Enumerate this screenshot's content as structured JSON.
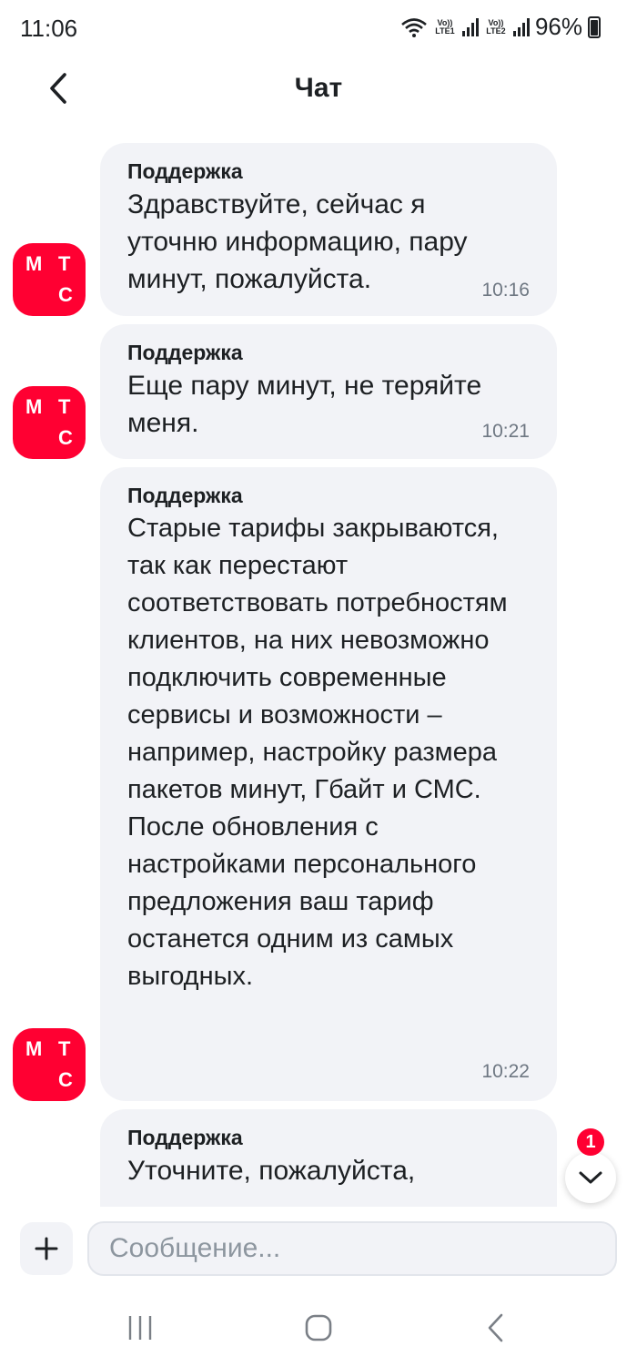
{
  "status_bar": {
    "time": "11:06",
    "volte1": "Vo)) LTE1",
    "volte2": "Vo)) LTE2",
    "battery": "96%"
  },
  "header": {
    "title": "Чат"
  },
  "avatar": {
    "letters": [
      "М",
      "Т",
      "С"
    ],
    "color": "#ff0032"
  },
  "messages": [
    {
      "sender": "Поддержка",
      "text": "Здравствуйте, сейчас я уточню информацию, пару минут, пожалуйста.",
      "time": "10:16"
    },
    {
      "sender": "Поддержка",
      "text": "Еще пару минут, не теряйте меня.",
      "time": "10:21"
    },
    {
      "sender": "Поддержка",
      "text": "Старые тарифы закрываются, так как перестают соответствовать потребностям клиентов, на них невозможно подключить современные сервисы и возможности – например, настройку размера пакетов минут, Гбайт и СМС. После обновления с настройками персонального предложения ваш тариф останется одним из самых выгодных.",
      "time": "10:22"
    },
    {
      "sender": "Поддержка",
      "text": "Уточните, пожалуйста,",
      "time": ""
    }
  ],
  "scroll": {
    "unread_count": "1"
  },
  "input": {
    "placeholder": "Сообщение..."
  },
  "colors": {
    "brand": "#ff0032",
    "bubble": "#f2f3f7",
    "text": "#1d2023",
    "muted": "#6e7782"
  }
}
